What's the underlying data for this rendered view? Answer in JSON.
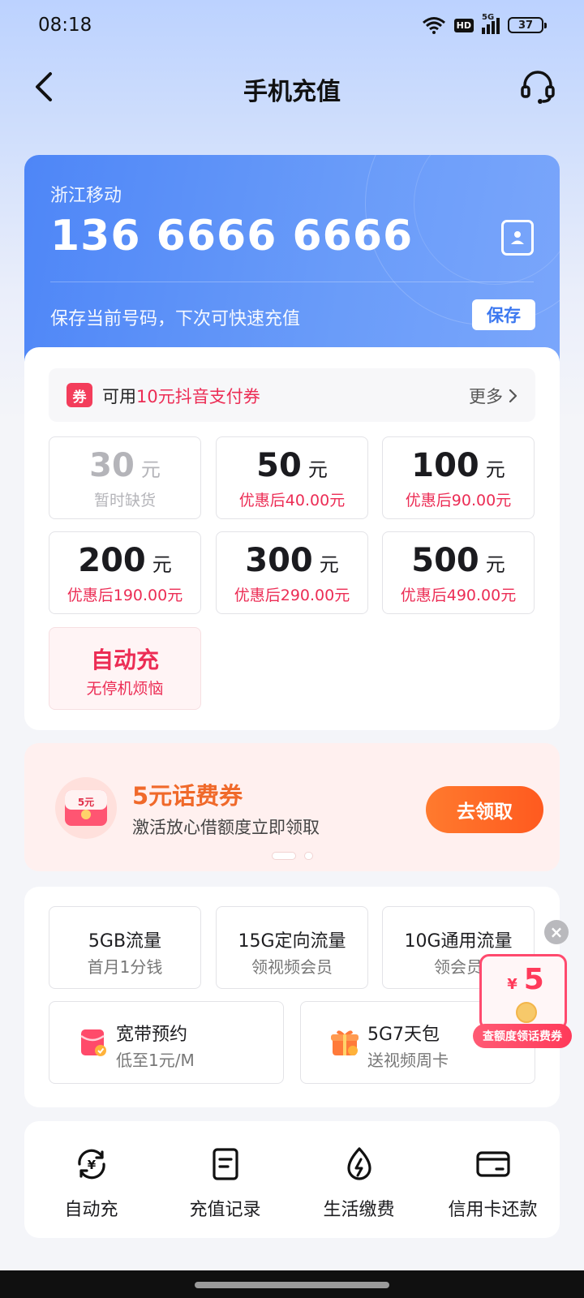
{
  "status_bar": {
    "time": "08:18",
    "hd": "HD",
    "network": "5G",
    "battery": "37"
  },
  "header": {
    "title": "手机充值"
  },
  "account": {
    "carrier": "浙江移动",
    "phone_number": "136 6666 6666",
    "save_hint": "保存当前号码，下次可快速充值",
    "save_label": "保存",
    "brand_color": "#4e86f7"
  },
  "coupon_bar": {
    "tag": "券",
    "prefix": "可用",
    "highlight": "10元抖音支付券",
    "more": "更多",
    "accent_color": "#ec2d55"
  },
  "amounts": [
    {
      "value": "30",
      "unit": "元",
      "sub": "暂时缺货",
      "disabled": true
    },
    {
      "value": "50",
      "unit": "元",
      "sub": "优惠后40.00元"
    },
    {
      "value": "100",
      "unit": "元",
      "sub": "优惠后90.00元"
    },
    {
      "value": "200",
      "unit": "元",
      "sub": "优惠后190.00元"
    },
    {
      "value": "300",
      "unit": "元",
      "sub": "优惠后290.00元"
    },
    {
      "value": "500",
      "unit": "元",
      "sub": "优惠后490.00元"
    }
  ],
  "auto_recharge": {
    "title": "自动充",
    "sub": "无停机烦恼"
  },
  "promo": {
    "icon_text": "5元",
    "title": "5元话费券",
    "subtitle": "激活放心借额度立即领取",
    "button": "去领取",
    "pages": 2,
    "active_page": 1
  },
  "packs": [
    {
      "title": "5GB流量",
      "sub": "首月1分钱"
    },
    {
      "title": "15G定向流量",
      "sub": "领视频会员"
    },
    {
      "title": "10G通用流量",
      "sub": "领会员"
    }
  ],
  "packs_wide": [
    {
      "title": "宽带预约",
      "sub": "低至1元/M",
      "icon": "red-envelope-icon"
    },
    {
      "title": "5G7天包",
      "sub": "送视频周卡",
      "icon": "gift-icon"
    }
  ],
  "floating_coupon": {
    "currency": "¥",
    "value": "5",
    "label": "查额度领话费券",
    "close": "×"
  },
  "services": [
    {
      "label": "自动充",
      "icon": "auto-recharge-icon"
    },
    {
      "label": "充值记录",
      "icon": "record-icon"
    },
    {
      "label": "生活缴费",
      "icon": "utility-icon"
    },
    {
      "label": "信用卡还款",
      "icon": "credit-card-icon"
    }
  ]
}
